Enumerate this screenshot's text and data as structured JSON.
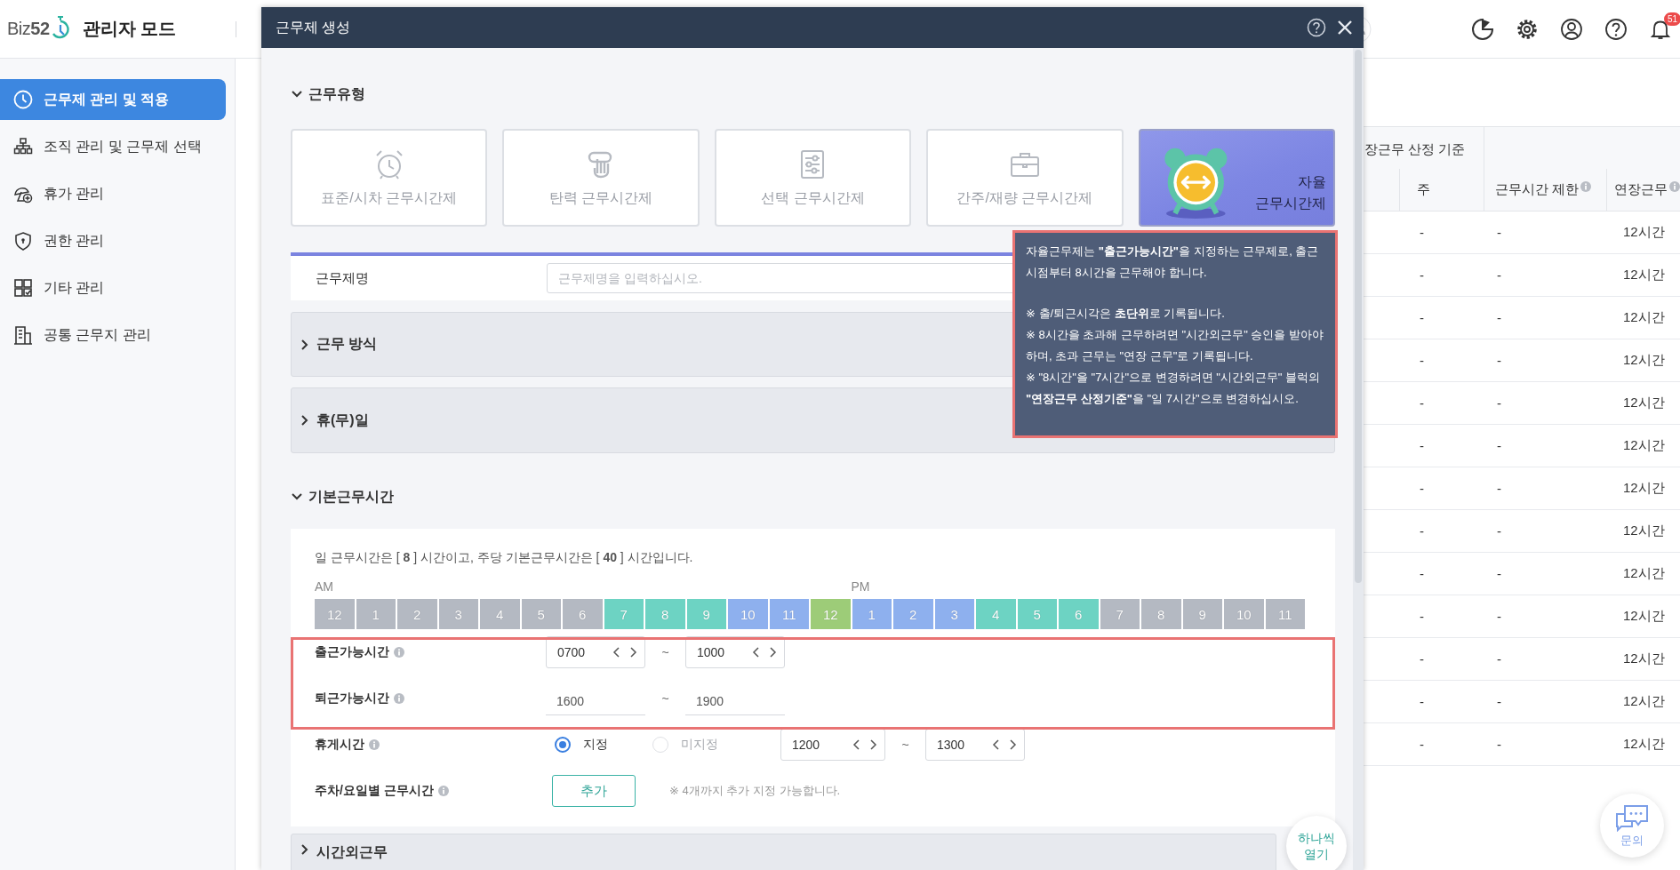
{
  "header": {
    "logo": "Biz**52**",
    "title": "관리자 모드",
    "notification_count": "51"
  },
  "sidebar": {
    "items": [
      {
        "label": "근무제 관리 및 적용",
        "selected": true
      },
      {
        "label": "조직 관리 및 근무제 선택",
        "selected": false
      },
      {
        "label": "휴가 관리",
        "selected": false
      },
      {
        "label": "권한 관리",
        "selected": false
      },
      {
        "label": "기타 관리",
        "selected": false
      },
      {
        "label": "공통 근무지 관리",
        "selected": false
      }
    ]
  },
  "table": {
    "group_heading": "장근무 산정 기준",
    "columns": [
      {
        "label": "주",
        "info": false
      },
      {
        "label": "근무시간 제한",
        "info": true
      },
      {
        "label": "연장근무",
        "info": true
      }
    ],
    "rows": [
      {
        "cells": [
          "-",
          "-",
          "12시간"
        ]
      },
      {
        "cells": [
          "-",
          "-",
          "12시간"
        ]
      },
      {
        "cells": [
          "-",
          "-",
          "12시간"
        ]
      },
      {
        "cells": [
          "-",
          "-",
          "12시간"
        ]
      },
      {
        "cells": [
          "-",
          "-",
          "12시간"
        ]
      },
      {
        "cells": [
          "-",
          "-",
          "12시간"
        ]
      },
      {
        "cells": [
          "-",
          "-",
          "12시간"
        ]
      },
      {
        "cells": [
          "-",
          "-",
          "12시간"
        ]
      },
      {
        "cells": [
          "-",
          "-",
          "12시간"
        ]
      },
      {
        "cells": [
          "-",
          "-",
          "12시간"
        ]
      },
      {
        "cells": [
          "-",
          "-",
          "12시간"
        ]
      },
      {
        "cells": [
          "-",
          "-",
          "12시간"
        ]
      },
      {
        "cells": [
          "-",
          "-",
          "12시간"
        ]
      }
    ]
  },
  "modal": {
    "title": "근무제 생성",
    "types": {
      "heading": "근무유형",
      "expanded": true,
      "cards": [
        {
          "label": "표준/시차 근무시간제",
          "selected": false
        },
        {
          "label": "탄력 근무시간제",
          "selected": false
        },
        {
          "label": "선택 근무시간제",
          "selected": false
        },
        {
          "label": "간주/재량 근무시간제",
          "selected": false
        },
        {
          "label": "자율 근무시간제",
          "selected": true
        }
      ]
    },
    "name_row": {
      "label": "근무제명",
      "placeholder": "근무제명을 입력하십시오."
    },
    "panels": [
      {
        "label": "근무 방식",
        "expanded": false
      },
      {
        "label": "휴(무)일",
        "expanded": false
      }
    ],
    "basic": {
      "heading": "기본근무시간",
      "expanded": true,
      "summary": "일 근무시간은 [ **8** ] 시간이고, 주당 기본근무시간은 [ **40** ] 시간입니다.",
      "am_label": "AM",
      "pm_label": "PM",
      "hours": [
        {
          "label": "12",
          "kind": "off"
        },
        {
          "label": "1",
          "kind": "off"
        },
        {
          "label": "2",
          "kind": "off"
        },
        {
          "label": "3",
          "kind": "off"
        },
        {
          "label": "4",
          "kind": "off"
        },
        {
          "label": "5",
          "kind": "off"
        },
        {
          "label": "6",
          "kind": "off"
        },
        {
          "label": "7",
          "kind": "flex"
        },
        {
          "label": "8",
          "kind": "flex"
        },
        {
          "label": "9",
          "kind": "flex"
        },
        {
          "label": "10",
          "kind": "core"
        },
        {
          "label": "11",
          "kind": "core"
        },
        {
          "label": "12",
          "kind": "break"
        },
        {
          "label": "1",
          "kind": "core"
        },
        {
          "label": "2",
          "kind": "core"
        },
        {
          "label": "3",
          "kind": "core"
        },
        {
          "label": "4",
          "kind": "flex"
        },
        {
          "label": "5",
          "kind": "flex"
        },
        {
          "label": "6",
          "kind": "flex"
        },
        {
          "label": "7",
          "kind": "off"
        },
        {
          "label": "8",
          "kind": "off"
        },
        {
          "label": "9",
          "kind": "off"
        },
        {
          "label": "10",
          "kind": "off"
        },
        {
          "label": "11",
          "kind": "off"
        }
      ],
      "rows": [
        {
          "kind": "spinner_range",
          "label": "출근가능시간",
          "info": true,
          "from": "0700",
          "separator": "~",
          "to": "1000"
        },
        {
          "kind": "plain_range",
          "label": "퇴근가능시간",
          "info": true,
          "from": "1600",
          "separator": "~",
          "to": "1900"
        },
        {
          "kind": "break",
          "label": "휴게시간",
          "info": true,
          "options": [
            {
              "label": "지정",
              "selected": true,
              "disabled": false
            },
            {
              "label": "미지정",
              "selected": false,
              "disabled": true
            }
          ],
          "from": "1200",
          "separator": "~",
          "to": "1300"
        },
        {
          "kind": "add",
          "label": "주차/요일별 근무시간",
          "info": true,
          "button": "추가",
          "note": "※ 4개까지 추가 지정 가능합니다."
        }
      ]
    },
    "more_panels": [
      {
        "label": "시간외근무",
        "expanded": false
      }
    ],
    "float_button": "하나씩 열기"
  },
  "tooltip": {
    "paragraphs": [
      {
        "kind": "lead",
        "text": "자율근무제는 **\"출근가능시간\"**을 지정하는 근무제로, 출근 시점부터 8시간을 근무해야 합니다."
      },
      {
        "kind": "note",
        "text": "※ 출/퇴근시각은 **초단위**로 기록됩니다."
      },
      {
        "kind": "note",
        "text": "※ 8시간을 초과해 근무하려면 \"시간외근무\" 승인을 받아야 하며, 초과 근무는 \"연장 근무\"로 기록됩니다."
      },
      {
        "kind": "note",
        "text": "※ \"8시간\"을 \"7시간\"으로 변경하려면 \"시간외근무\" 블럭의 **\"연장근무 산정기준\"**을 \"일 7시간\"으로 변경하십시오."
      }
    ]
  },
  "chat_button": {
    "label": "문의"
  }
}
